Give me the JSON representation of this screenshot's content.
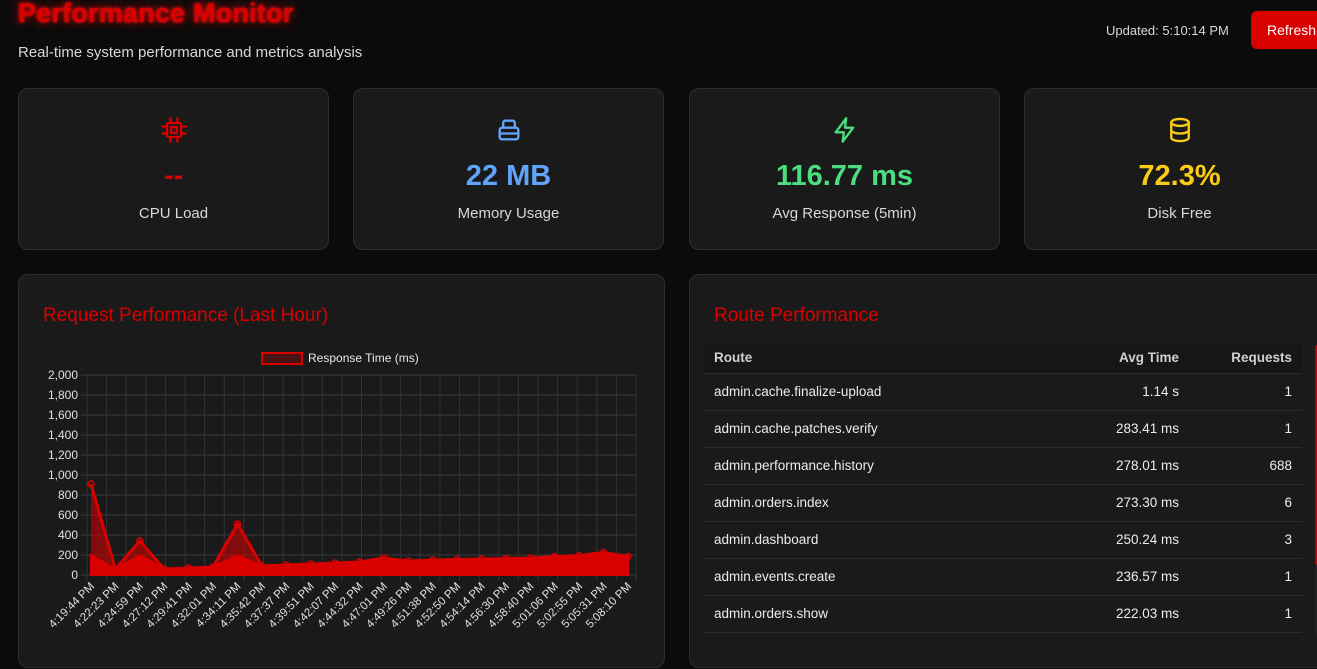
{
  "header": {
    "title": "Performance Monitor",
    "subtitle": "Real-time system performance and metrics analysis",
    "updated": "Updated: 5:10:14 PM",
    "refresh_label": "Refresh"
  },
  "colors": {
    "accent": "#d90000",
    "cpu": "#d90000",
    "memory": "#60a5fa",
    "response": "#4ade80",
    "disk": "#facc15"
  },
  "cards": [
    {
      "icon": "cpu-icon",
      "value": "--",
      "label": "CPU Load"
    },
    {
      "icon": "memory-icon",
      "value": "22 MB",
      "label": "Memory Usage"
    },
    {
      "icon": "lightning-icon",
      "value": "116.77 ms",
      "label": "Avg Response (5min)"
    },
    {
      "icon": "database-icon",
      "value": "72.3%",
      "label": "Disk Free"
    }
  ],
  "request_panel": {
    "title": "Request Performance (Last Hour)"
  },
  "route_panel": {
    "title": "Route Performance",
    "columns": [
      "Route",
      "Avg Time",
      "Requests"
    ],
    "rows": [
      {
        "route": "admin.cache.finalize-upload",
        "avg": "1.14 s",
        "requests": "1"
      },
      {
        "route": "admin.cache.patches.verify",
        "avg": "283.41 ms",
        "requests": "1"
      },
      {
        "route": "admin.performance.history",
        "avg": "278.01 ms",
        "requests": "688"
      },
      {
        "route": "admin.orders.index",
        "avg": "273.30 ms",
        "requests": "6"
      },
      {
        "route": "admin.dashboard",
        "avg": "250.24 ms",
        "requests": "3"
      },
      {
        "route": "admin.events.create",
        "avg": "236.57 ms",
        "requests": "1"
      },
      {
        "route": "admin.orders.show",
        "avg": "222.03 ms",
        "requests": "1"
      }
    ]
  },
  "chart_data": {
    "type": "line",
    "legend": [
      "Response Time (ms)"
    ],
    "ylim": [
      0,
      2000
    ],
    "yticks": [
      "2,000",
      "1,800",
      "1,600",
      "1,400",
      "1,200",
      "1,000",
      "800",
      "600",
      "400",
      "200",
      "0"
    ],
    "x": [
      "4:19:44 PM",
      "4:22:23 PM",
      "4:24:59 PM",
      "4:27:12 PM",
      "4:29:41 PM",
      "4:32:01 PM",
      "4:34:11 PM",
      "4:35:42 PM",
      "4:37:37 PM",
      "4:39:51 PM",
      "4:42:07 PM",
      "4:44:32 PM",
      "4:47:01 PM",
      "4:49:26 PM",
      "4:51:38 PM",
      "4:52:50 PM",
      "4:54:14 PM",
      "4:56:30 PM",
      "4:58:40 PM",
      "5:01:06 PM",
      "5:02:55 PM",
      "5:05:31 PM",
      "5:08:10 PM"
    ],
    "series": [
      {
        "name": "Response Time (ms)",
        "values": [
          910,
          60,
          340,
          60,
          70,
          80,
          510,
          90,
          100,
          110,
          120,
          130,
          170,
          140,
          150,
          155,
          160,
          165,
          170,
          185,
          195,
          225,
          185
        ]
      }
    ]
  }
}
